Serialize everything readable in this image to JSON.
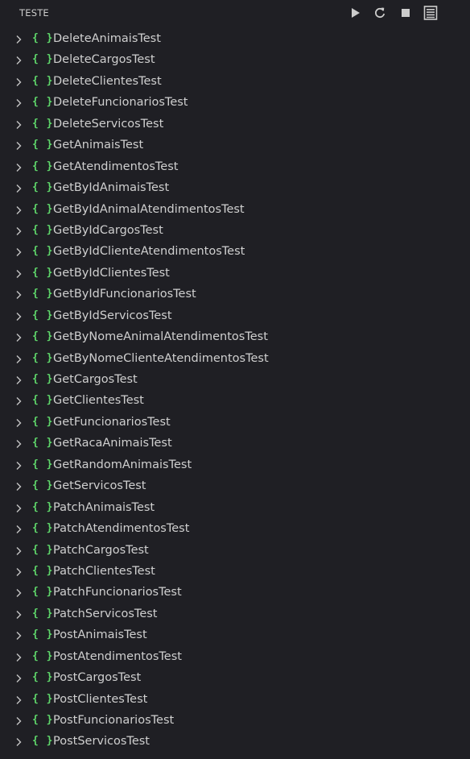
{
  "header": {
    "title": "TESTE",
    "toolbar": [
      {
        "name": "run-icon"
      },
      {
        "name": "refresh-icon"
      },
      {
        "name": "stop-icon"
      },
      {
        "name": "output-icon"
      }
    ]
  },
  "tests": {
    "icon": "braces-icon",
    "accent_color": "#5fd86b",
    "items": [
      "DeleteAnimaisTest",
      "DeleteCargosTest",
      "DeleteClientesTest",
      "DeleteFuncionariosTest",
      "DeleteServicosTest",
      "GetAnimaisTest",
      "GetAtendimentosTest",
      "GetByIdAnimaisTest",
      "GetByIdAnimalAtendimentosTest",
      "GetByIdCargosTest",
      "GetByIdClienteAtendimentosTest",
      "GetByIdClientesTest",
      "GetByIdFuncionariosTest",
      "GetByIdServicosTest",
      "GetByNomeAnimalAtendimentosTest",
      "GetByNomeClienteAtendimentosTest",
      "GetCargosTest",
      "GetClientesTest",
      "GetFuncionariosTest",
      "GetRacaAnimaisTest",
      "GetRandomAnimaisTest",
      "GetServicosTest",
      "PatchAnimaisTest",
      "PatchAtendimentosTest",
      "PatchCargosTest",
      "PatchClientesTest",
      "PatchFuncionariosTest",
      "PatchServicosTest",
      "PostAnimaisTest",
      "PostAtendimentosTest",
      "PostCargosTest",
      "PostClientesTest",
      "PostFuncionariosTest",
      "PostServicosTest"
    ]
  }
}
